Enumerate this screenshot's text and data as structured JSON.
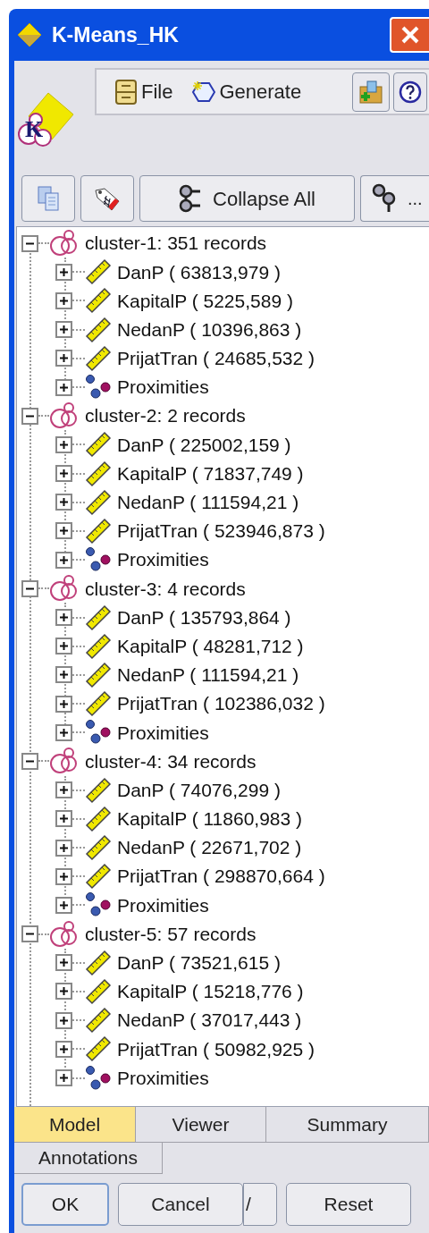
{
  "window": {
    "title": "K-Means_HK"
  },
  "logo": {
    "letter": "K"
  },
  "menu": [
    {
      "label": "File",
      "kind": "file"
    },
    {
      "label": "Generate",
      "kind": "generate"
    }
  ],
  "toolbar": {
    "collapse_label": "Collapse All",
    "more_label": "..."
  },
  "tree": [
    {
      "label": "cluster-1: 351 records",
      "expanded": true,
      "children": [
        {
          "label": "DanP ( 63813,979 )",
          "kind": "field",
          "expanded": false
        },
        {
          "label": "KapitalP ( 5225,589 )",
          "kind": "field",
          "expanded": false
        },
        {
          "label": "NedanP ( 10396,863 )",
          "kind": "field",
          "expanded": false
        },
        {
          "label": "PrijatTran ( 24685,532 )",
          "kind": "field",
          "expanded": false
        },
        {
          "label": "Proximities",
          "kind": "proximities",
          "expanded": false
        }
      ]
    },
    {
      "label": "cluster-2: 2 records",
      "expanded": true,
      "children": [
        {
          "label": "DanP ( 225002,159 )",
          "kind": "field",
          "expanded": false
        },
        {
          "label": "KapitalP ( 71837,749 )",
          "kind": "field",
          "expanded": false
        },
        {
          "label": "NedanP ( 111594,21 )",
          "kind": "field",
          "expanded": false
        },
        {
          "label": "PrijatTran ( 523946,873 )",
          "kind": "field",
          "expanded": false
        },
        {
          "label": "Proximities",
          "kind": "proximities",
          "expanded": false
        }
      ]
    },
    {
      "label": "cluster-3: 4 records",
      "expanded": true,
      "children": [
        {
          "label": "DanP ( 135793,864 )",
          "kind": "field",
          "expanded": false
        },
        {
          "label": "KapitalP ( 48281,712 )",
          "kind": "field",
          "expanded": false
        },
        {
          "label": "NedanP ( 111594,21 )",
          "kind": "field",
          "expanded": false
        },
        {
          "label": "PrijatTran ( 102386,032 )",
          "kind": "field",
          "expanded": false
        },
        {
          "label": "Proximities",
          "kind": "proximities",
          "expanded": false
        }
      ]
    },
    {
      "label": "cluster-4: 34 records",
      "expanded": true,
      "children": [
        {
          "label": "DanP ( 74076,299 )",
          "kind": "field",
          "expanded": false
        },
        {
          "label": "KapitalP ( 11860,983 )",
          "kind": "field",
          "expanded": false
        },
        {
          "label": "NedanP ( 22671,702 )",
          "kind": "field",
          "expanded": false
        },
        {
          "label": "PrijatTran ( 298870,664 )",
          "kind": "field",
          "expanded": false
        },
        {
          "label": "Proximities",
          "kind": "proximities",
          "expanded": false
        }
      ]
    },
    {
      "label": "cluster-5: 57 records",
      "expanded": true,
      "children": [
        {
          "label": "DanP ( 73521,615 )",
          "kind": "field",
          "expanded": false
        },
        {
          "label": "KapitalP ( 15218,776 )",
          "kind": "field",
          "expanded": false
        },
        {
          "label": "NedanP ( 37017,443 )",
          "kind": "field",
          "expanded": false
        },
        {
          "label": "PrijatTran ( 50982,925 )",
          "kind": "field",
          "expanded": false
        },
        {
          "label": "Proximities",
          "kind": "proximities",
          "expanded": false
        }
      ]
    }
  ],
  "tabs": [
    {
      "label": "Model",
      "selected": true
    },
    {
      "label": "Viewer",
      "selected": false
    },
    {
      "label": "Summary",
      "selected": false
    },
    {
      "label": "Annotations",
      "selected": false
    }
  ],
  "buttons": [
    {
      "label": "OK",
      "kind": "default"
    },
    {
      "label": "Cancel",
      "kind": "normal"
    },
    {
      "label": "/",
      "kind": "partial"
    },
    {
      "label": "Reset",
      "kind": "normal"
    }
  ]
}
